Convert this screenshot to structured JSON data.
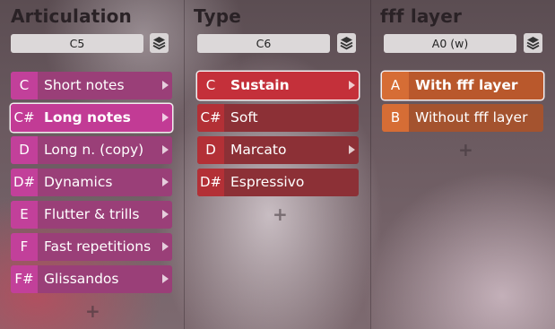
{
  "columns": [
    {
      "title": "Articulation",
      "note": "C5",
      "rows": [
        {
          "key": "C",
          "label": "Short notes",
          "arrow": true
        },
        {
          "key": "C#",
          "label": "Long notes",
          "arrow": true,
          "selected": true
        },
        {
          "key": "D",
          "label": "Long n. (copy)",
          "arrow": true
        },
        {
          "key": "D#",
          "label": "Dynamics",
          "arrow": true
        },
        {
          "key": "E",
          "label": "Flutter & trills",
          "arrow": true
        },
        {
          "key": "F",
          "label": "Fast repetitions",
          "arrow": true
        },
        {
          "key": "F#",
          "label": "Glissandos",
          "arrow": true
        }
      ]
    },
    {
      "title": "Type",
      "note": "C6",
      "rows": [
        {
          "key": "C",
          "label": "Sustain",
          "arrow": true,
          "selected": true
        },
        {
          "key": "C#",
          "label": "Soft"
        },
        {
          "key": "D",
          "label": "Marcato",
          "arrow": true
        },
        {
          "key": "D#",
          "label": "Espressivo"
        }
      ]
    },
    {
      "title": "fff layer",
      "note": "A0 (w)",
      "rows": [
        {
          "key": "A",
          "label": "With fff layer",
          "selected": true
        },
        {
          "key": "B",
          "label": "Without fff layer"
        }
      ]
    }
  ],
  "colors": {
    "articulation_row": "#9a3f78",
    "articulation_key": "#c2409a",
    "articulation_selected": "#c23b95",
    "type_row": "#8c3036",
    "type_key": "#b33036",
    "type_selected": "#c4303a",
    "fff_row": "#a4532f",
    "fff_key": "#d66d35",
    "fff_selected": "#b9582c"
  },
  "icons": {
    "layer": "layers-icon",
    "submenu": "chevron-right-icon",
    "add": "plus-icon"
  },
  "add_label": "+"
}
